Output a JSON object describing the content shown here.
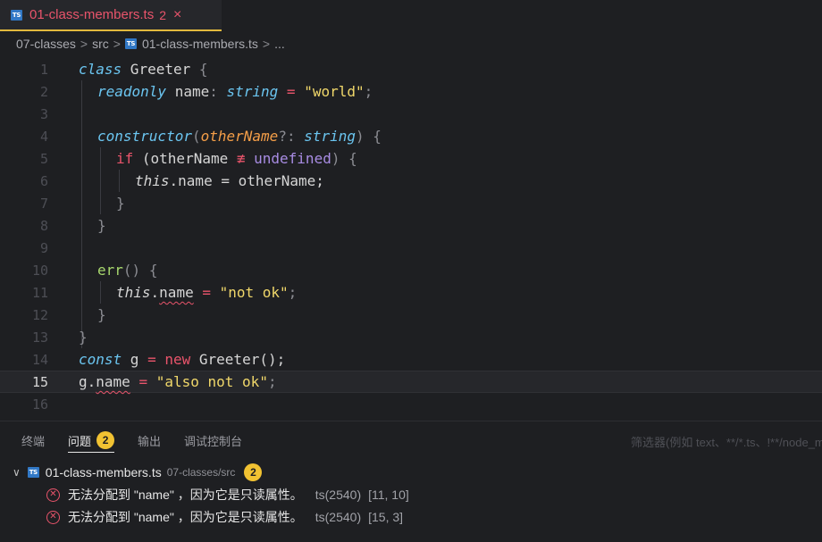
{
  "tab": {
    "icon": "TS",
    "title": "01-class-members.ts",
    "problem_count": "2",
    "close": "×"
  },
  "breadcrumb": {
    "items": [
      "07-classes",
      "src",
      "01-class-members.ts",
      "..."
    ],
    "separator": ">"
  },
  "editor": {
    "active_line": 15,
    "line_numbers": [
      "1",
      "2",
      "3",
      "4",
      "5",
      "6",
      "7",
      "8",
      "9",
      "10",
      "11",
      "12",
      "13",
      "14",
      "15",
      "16"
    ],
    "tokens": {
      "l1": [
        "class",
        " Greeter ",
        "{"
      ],
      "l2": [
        "readonly",
        " name",
        ": ",
        "string",
        " = ",
        "\"world\"",
        ";"
      ],
      "l4": [
        "constructor",
        "(",
        "otherName",
        "?: ",
        "string",
        ") ",
        "{"
      ],
      "l5": [
        "if",
        " (otherName ",
        "≢",
        " undefined",
        ") ",
        "{"
      ],
      "l6": [
        "this",
        ".name = otherName;"
      ],
      "l7": [
        "}"
      ],
      "l8": [
        "}"
      ],
      "l10": [
        "err",
        "() ",
        "{"
      ],
      "l11": [
        "this",
        ".",
        "name",
        " = ",
        "\"not ok\"",
        ";"
      ],
      "l12": [
        "}"
      ],
      "l13": [
        "}"
      ],
      "l14": [
        "const",
        " g ",
        "=",
        " ",
        "new",
        " Greeter();"
      ],
      "l15": [
        "g.",
        "name",
        " ",
        "=",
        " ",
        "\"also not ok\"",
        ";"
      ]
    }
  },
  "panel": {
    "tabs": [
      {
        "label": "终端"
      },
      {
        "label": "问题",
        "badge": "2"
      },
      {
        "label": "输出"
      },
      {
        "label": "调试控制台"
      }
    ],
    "filter_placeholder": "筛选器(例如 text、**/*.ts、!**/node_mo",
    "group": {
      "file": "01-class-members.ts",
      "path": "07-classes/src",
      "count": "2"
    },
    "problems": [
      {
        "message": "无法分配到 \"name\" ，因为它是只读属性。",
        "source": "ts(2540)",
        "position": "[11, 10]"
      },
      {
        "message": "无法分配到 \"name\" ，因为它是只读属性。",
        "source": "ts(2540)",
        "position": "[15, 3]"
      }
    ]
  },
  "colors": {
    "accent": "#e2b93d",
    "error": "#e9546b",
    "badge": "#f1c232",
    "ts_icon": "#3178c6"
  }
}
